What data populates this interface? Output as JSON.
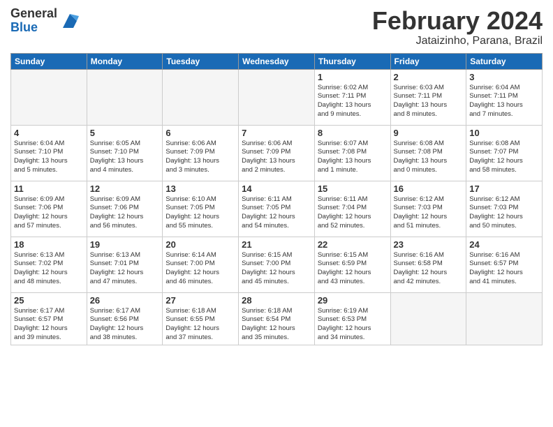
{
  "logo": {
    "general": "General",
    "blue": "Blue"
  },
  "title": {
    "month_year": "February 2024",
    "location": "Jataizinho, Parana, Brazil"
  },
  "headers": [
    "Sunday",
    "Monday",
    "Tuesday",
    "Wednesday",
    "Thursday",
    "Friday",
    "Saturday"
  ],
  "weeks": [
    [
      {
        "day": "",
        "info": ""
      },
      {
        "day": "",
        "info": ""
      },
      {
        "day": "",
        "info": ""
      },
      {
        "day": "",
        "info": ""
      },
      {
        "day": "1",
        "info": "Sunrise: 6:02 AM\nSunset: 7:11 PM\nDaylight: 13 hours\nand 9 minutes."
      },
      {
        "day": "2",
        "info": "Sunrise: 6:03 AM\nSunset: 7:11 PM\nDaylight: 13 hours\nand 8 minutes."
      },
      {
        "day": "3",
        "info": "Sunrise: 6:04 AM\nSunset: 7:11 PM\nDaylight: 13 hours\nand 7 minutes."
      }
    ],
    [
      {
        "day": "4",
        "info": "Sunrise: 6:04 AM\nSunset: 7:10 PM\nDaylight: 13 hours\nand 5 minutes."
      },
      {
        "day": "5",
        "info": "Sunrise: 6:05 AM\nSunset: 7:10 PM\nDaylight: 13 hours\nand 4 minutes."
      },
      {
        "day": "6",
        "info": "Sunrise: 6:06 AM\nSunset: 7:09 PM\nDaylight: 13 hours\nand 3 minutes."
      },
      {
        "day": "7",
        "info": "Sunrise: 6:06 AM\nSunset: 7:09 PM\nDaylight: 13 hours\nand 2 minutes."
      },
      {
        "day": "8",
        "info": "Sunrise: 6:07 AM\nSunset: 7:08 PM\nDaylight: 13 hours\nand 1 minute."
      },
      {
        "day": "9",
        "info": "Sunrise: 6:08 AM\nSunset: 7:08 PM\nDaylight: 13 hours\nand 0 minutes."
      },
      {
        "day": "10",
        "info": "Sunrise: 6:08 AM\nSunset: 7:07 PM\nDaylight: 12 hours\nand 58 minutes."
      }
    ],
    [
      {
        "day": "11",
        "info": "Sunrise: 6:09 AM\nSunset: 7:06 PM\nDaylight: 12 hours\nand 57 minutes."
      },
      {
        "day": "12",
        "info": "Sunrise: 6:09 AM\nSunset: 7:06 PM\nDaylight: 12 hours\nand 56 minutes."
      },
      {
        "day": "13",
        "info": "Sunrise: 6:10 AM\nSunset: 7:05 PM\nDaylight: 12 hours\nand 55 minutes."
      },
      {
        "day": "14",
        "info": "Sunrise: 6:11 AM\nSunset: 7:05 PM\nDaylight: 12 hours\nand 54 minutes."
      },
      {
        "day": "15",
        "info": "Sunrise: 6:11 AM\nSunset: 7:04 PM\nDaylight: 12 hours\nand 52 minutes."
      },
      {
        "day": "16",
        "info": "Sunrise: 6:12 AM\nSunset: 7:03 PM\nDaylight: 12 hours\nand 51 minutes."
      },
      {
        "day": "17",
        "info": "Sunrise: 6:12 AM\nSunset: 7:03 PM\nDaylight: 12 hours\nand 50 minutes."
      }
    ],
    [
      {
        "day": "18",
        "info": "Sunrise: 6:13 AM\nSunset: 7:02 PM\nDaylight: 12 hours\nand 48 minutes."
      },
      {
        "day": "19",
        "info": "Sunrise: 6:13 AM\nSunset: 7:01 PM\nDaylight: 12 hours\nand 47 minutes."
      },
      {
        "day": "20",
        "info": "Sunrise: 6:14 AM\nSunset: 7:00 PM\nDaylight: 12 hours\nand 46 minutes."
      },
      {
        "day": "21",
        "info": "Sunrise: 6:15 AM\nSunset: 7:00 PM\nDaylight: 12 hours\nand 45 minutes."
      },
      {
        "day": "22",
        "info": "Sunrise: 6:15 AM\nSunset: 6:59 PM\nDaylight: 12 hours\nand 43 minutes."
      },
      {
        "day": "23",
        "info": "Sunrise: 6:16 AM\nSunset: 6:58 PM\nDaylight: 12 hours\nand 42 minutes."
      },
      {
        "day": "24",
        "info": "Sunrise: 6:16 AM\nSunset: 6:57 PM\nDaylight: 12 hours\nand 41 minutes."
      }
    ],
    [
      {
        "day": "25",
        "info": "Sunrise: 6:17 AM\nSunset: 6:57 PM\nDaylight: 12 hours\nand 39 minutes."
      },
      {
        "day": "26",
        "info": "Sunrise: 6:17 AM\nSunset: 6:56 PM\nDaylight: 12 hours\nand 38 minutes."
      },
      {
        "day": "27",
        "info": "Sunrise: 6:18 AM\nSunset: 6:55 PM\nDaylight: 12 hours\nand 37 minutes."
      },
      {
        "day": "28",
        "info": "Sunrise: 6:18 AM\nSunset: 6:54 PM\nDaylight: 12 hours\nand 35 minutes."
      },
      {
        "day": "29",
        "info": "Sunrise: 6:19 AM\nSunset: 6:53 PM\nDaylight: 12 hours\nand 34 minutes."
      },
      {
        "day": "",
        "info": ""
      },
      {
        "day": "",
        "info": ""
      }
    ]
  ]
}
